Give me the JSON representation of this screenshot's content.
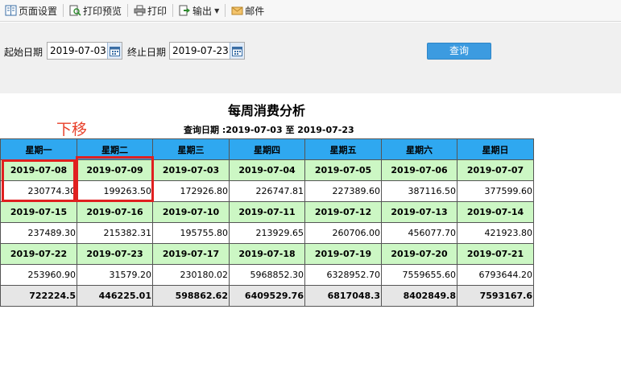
{
  "toolbar": {
    "page_setup": "页面设置",
    "print_preview": "打印预览",
    "print": "打印",
    "export": "输出",
    "mail": "邮件"
  },
  "filter": {
    "start_label": "起始日期",
    "start_value": "2019-07-03",
    "end_label": "终止日期",
    "end_value": "2019-07-23",
    "query_button": "查询"
  },
  "report": {
    "title": "每周消费分析",
    "query_date_label": "查询日期 :",
    "range_start": "2019-07-03",
    "range_to": "至",
    "range_end": "2019-07-23",
    "annotation": "下移",
    "headers": [
      "星期一",
      "星期二",
      "星期三",
      "星期四",
      "星期五",
      "星期六",
      "星期日"
    ],
    "weeks": [
      {
        "dates": [
          "2019-07-08",
          "2019-07-09",
          "2019-07-03",
          "2019-07-04",
          "2019-07-05",
          "2019-07-06",
          "2019-07-07"
        ],
        "values": [
          "230774.30",
          "199263.50",
          "172926.80",
          "226747.81",
          "227389.60",
          "387116.50",
          "377599.60"
        ]
      },
      {
        "dates": [
          "2019-07-15",
          "2019-07-16",
          "2019-07-10",
          "2019-07-11",
          "2019-07-12",
          "2019-07-13",
          "2019-07-14"
        ],
        "values": [
          "237489.30",
          "215382.31",
          "195755.80",
          "213929.65",
          "260706.00",
          "456077.70",
          "421923.80"
        ]
      },
      {
        "dates": [
          "2019-07-22",
          "2019-07-23",
          "2019-07-17",
          "2019-07-18",
          "2019-07-19",
          "2019-07-20",
          "2019-07-21"
        ],
        "values": [
          "253960.90",
          "31579.20",
          "230180.02",
          "5968852.30",
          "6328952.70",
          "7559655.60",
          "6793644.20"
        ]
      }
    ],
    "totals": [
      "722224.5",
      "446225.01",
      "598862.62",
      "6409529.76",
      "6817048.3",
      "8402849.8",
      "7593167.6"
    ]
  },
  "colors": {
    "header_bg": "#2fa8f0",
    "date_row_bg": "#ccf7c4",
    "total_row_bg": "#e6e6e6",
    "query_button_bg": "#3c9be0",
    "highlight": "#e02020"
  }
}
